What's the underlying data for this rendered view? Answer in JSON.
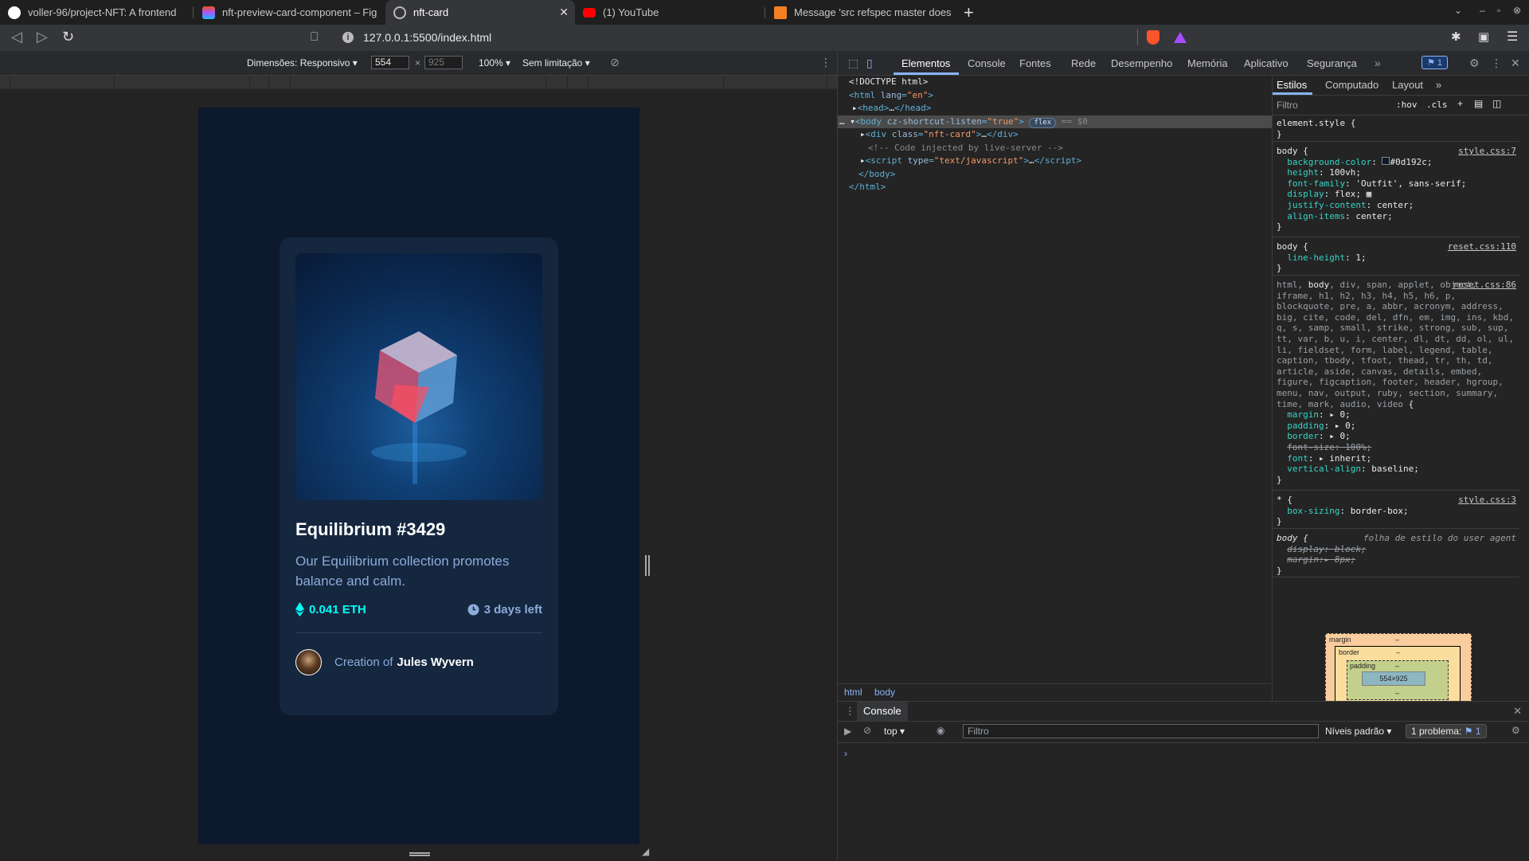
{
  "browser": {
    "tabs": [
      {
        "title": "voller-96/project-NFT: A frontend"
      },
      {
        "title": "nft-preview-card-component – Fig"
      },
      {
        "title": "nft-card",
        "active": true
      },
      {
        "title": "(1) YouTube"
      },
      {
        "title": "Message 'src refspec master does"
      }
    ],
    "url": "127.0.0.1:5500/index.html"
  },
  "device_toolbar": {
    "dimensions_label": "Dimensões: Responsivo",
    "width": "554",
    "height": "925",
    "zoom": "100%",
    "throttle": "Sem limitação"
  },
  "card": {
    "title": "Equilibrium #3429",
    "description": "Our Equilibrium collection promotes balance and calm.",
    "price": "0.041 ETH",
    "time_left": "3 days left",
    "creator_prefix": "Creation of",
    "creator_name": "Jules Wyvern"
  },
  "devtools": {
    "tabs": [
      "Elementos",
      "Console",
      "Fontes",
      "Rede",
      "Desempenho",
      "Memória",
      "Aplicativo",
      "Segurança"
    ],
    "issues_count": "1",
    "breadcrumbs": [
      "html",
      "body"
    ],
    "styles_tabs": [
      "Estilos",
      "Computado",
      "Layout"
    ],
    "styles_filter_placeholder": "Filtro",
    "hov": ":hov",
    "cls": ".cls",
    "box_model": {
      "content": "554×925",
      "margin": "margin",
      "border": "border",
      "padding": "padding",
      "dash": "–"
    },
    "console": {
      "title": "Console",
      "context": "top",
      "filter_placeholder": "Filtro",
      "levels": "Níveis padrão",
      "problems": "1 problema:",
      "problems_count": "1"
    }
  },
  "colors": {
    "page_bg": "#0d192c",
    "card_bg": "#15263f",
    "cyan": "#00fff8",
    "soft_blue": "#8bacd9"
  }
}
